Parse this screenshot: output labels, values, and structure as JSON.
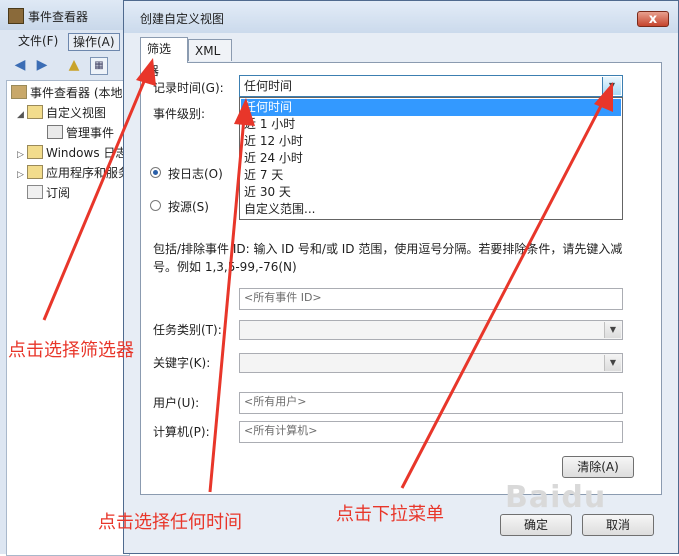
{
  "background_window": {
    "title": "事件查看器",
    "menu": [
      "文件(F)",
      "操作(A)"
    ],
    "tree": [
      {
        "label": "事件查看器 (本地)"
      },
      {
        "label": "自定义视图"
      },
      {
        "label": "管理事件"
      },
      {
        "label": "Windows 日志"
      },
      {
        "label": "应用程序和服务"
      },
      {
        "label": "订阅"
      }
    ]
  },
  "dialog": {
    "title": "创建自定义视图",
    "close_glyph": "x",
    "tabs": [
      "筛选器",
      "XML"
    ],
    "logged": {
      "label": "记录时间(G):",
      "value": "任何时间"
    },
    "level": {
      "label": "事件级别:"
    },
    "dropdown_options": [
      "任何时间",
      "近 1 小时",
      "近 12 小时",
      "近 24 小时",
      "近 7 天",
      "近 30 天",
      "自定义范围..."
    ],
    "radio_by_log": "按日志(O)",
    "radio_by_source": "按源(S)",
    "include_text_1": "包括/排除事件 ID: 输入 ID 号和/或 ID 范围，使用逗号分隔。若要排除条件，请先键入减",
    "include_text_2": "号。例如 1,3,5-99,-76(N)",
    "event_id_placeholder": "<所有事件 ID>",
    "task_category_label": "任务类别(T):",
    "keywords_label": "关键字(K):",
    "user_label": "用户(U):",
    "user_placeholder": "<所有用户>",
    "computer_label": "计算机(P):",
    "computer_placeholder": "<所有计算机>",
    "clear_button": "清除(A)",
    "ok_button": "确定",
    "cancel_button": "取消"
  },
  "annotations": {
    "select_filter": "点击选择筛选器",
    "select_any_time": "点击选择任何时间",
    "click_dropdown": "点击下拉菜单",
    "color": "#e8362a"
  },
  "watermark": "Baidu"
}
